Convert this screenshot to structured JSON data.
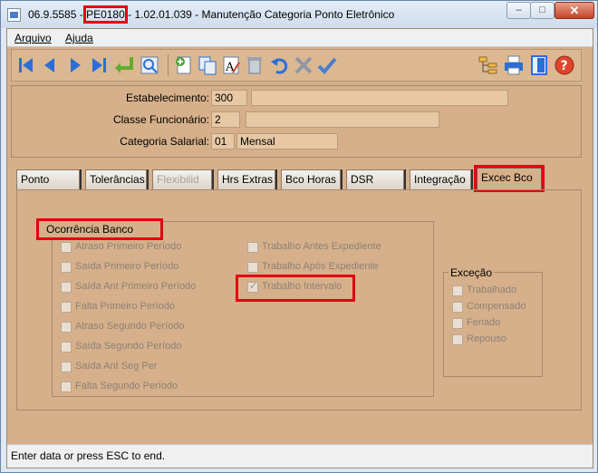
{
  "window": {
    "title_parts": [
      "06.9.5585 -",
      "PE0180",
      "- 1.02.01.039 - Manutenção Categoria Ponto Eletrônico"
    ],
    "controls": {
      "minimize": "–",
      "maximize": "□",
      "close": "✕"
    }
  },
  "menu": {
    "items": [
      "Arquivo",
      "Ajuda"
    ]
  },
  "toolbar": {
    "buttons": [
      "first-icon",
      "prev-icon",
      "next-icon",
      "last-icon",
      "goto-icon",
      "zoom-icon",
      "add-icon",
      "copy-icon",
      "edit-icon",
      "delete-icon",
      "undo-icon",
      "cancel-icon",
      "save-icon",
      "tree-icon",
      "print-icon",
      "exit-icon",
      "help-icon"
    ]
  },
  "form": {
    "estabelecimento": {
      "label": "Estabelecimento:",
      "code": "300",
      "desc": ""
    },
    "classe": {
      "label": "Classe Funcionário:",
      "code": "2",
      "desc": ""
    },
    "categoria": {
      "label": "Categoria Salarial:",
      "code": "01",
      "desc": "Mensal"
    }
  },
  "tabs": [
    {
      "label": "Ponto"
    },
    {
      "label": "Tolerâncias"
    },
    {
      "label": "Flexibilid"
    },
    {
      "label": "Hrs Extras"
    },
    {
      "label": "Bco Horas"
    },
    {
      "label": "DSR"
    },
    {
      "label": "Integração"
    },
    {
      "label": "Excec Bco"
    }
  ],
  "ocorrencia": {
    "title": "Ocorrência Banco",
    "left": [
      {
        "label": "Atraso Primeiro Período",
        "checked": false
      },
      {
        "label": "Saída Primeiro Período",
        "checked": false
      },
      {
        "label": "Saída Ant Primeiro Período",
        "checked": false
      },
      {
        "label": "Falta Primeiro Período",
        "checked": false
      },
      {
        "label": "Atraso Segundo Período",
        "checked": false
      },
      {
        "label": "Saída Segundo Período",
        "checked": false
      },
      {
        "label": "Saída Ant Seg Per",
        "checked": false
      },
      {
        "label": "Falta Segundo Período",
        "checked": false
      }
    ],
    "right": [
      {
        "label": "Trabalho Antes Expediente",
        "checked": false
      },
      {
        "label": "Trabalho Após Expediente",
        "checked": false
      },
      {
        "label": "Trabalho Intervalo",
        "checked": true
      }
    ]
  },
  "excecao": {
    "title": "Exceção",
    "items": [
      {
        "label": "Trabalhado",
        "checked": false
      },
      {
        "label": "Compensado",
        "checked": false
      },
      {
        "label": "Feriado",
        "checked": false
      },
      {
        "label": "Repouso",
        "checked": false
      }
    ]
  },
  "status": {
    "text": "Enter data or press ESC to end."
  },
  "colors": {
    "panel": "#d6b08a",
    "highlight": "#e3000f",
    "accent_blue": "#2b6fd6"
  }
}
